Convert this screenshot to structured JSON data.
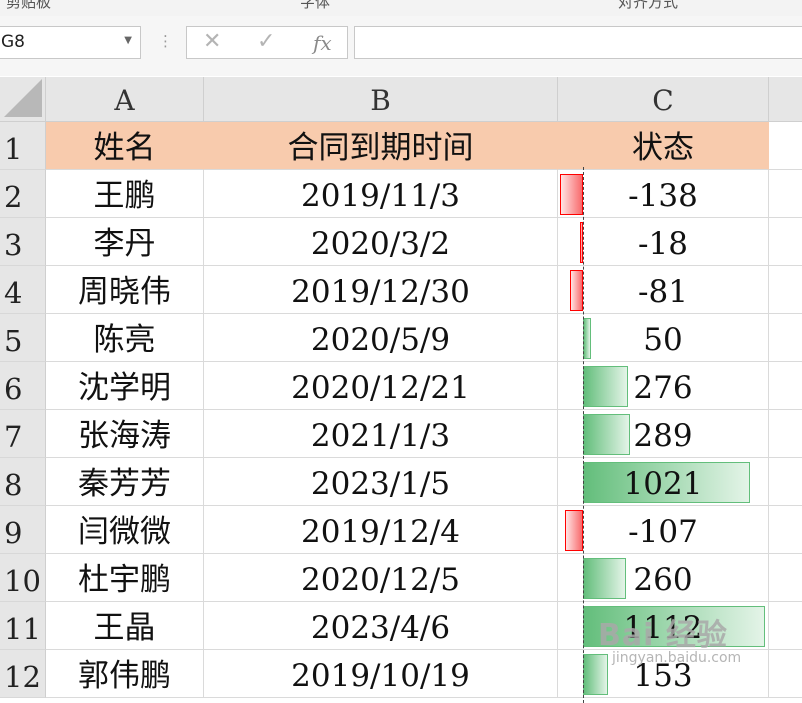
{
  "ribbon": {
    "groups": [
      "剪贴板",
      "字体",
      "对齐方式"
    ]
  },
  "formula_bar": {
    "name_box": "G8",
    "cancel_icon": "✕",
    "enter_icon": "✓",
    "function_label": "fx",
    "formula": ""
  },
  "columns": [
    "A",
    "B",
    "C"
  ],
  "row_numbers": [
    "1",
    "2",
    "3",
    "4",
    "5",
    "6",
    "7",
    "8",
    "9",
    "10",
    "11",
    "12"
  ],
  "header_row": {
    "name": "姓名",
    "date": "合同到期时间",
    "status": "状态",
    "fill_color": "#f8cbad"
  },
  "rows": [
    {
      "name": "王鹏",
      "date": "2019/11/3",
      "status": -138
    },
    {
      "name": "李丹",
      "date": "2020/3/2",
      "status": -18
    },
    {
      "name": "周晓伟",
      "date": "2019/12/30",
      "status": -81
    },
    {
      "name": "陈亮",
      "date": "2020/5/9",
      "status": 50
    },
    {
      "name": "沈学明",
      "date": "2020/12/21",
      "status": 276
    },
    {
      "name": "张海涛",
      "date": "2021/1/3",
      "status": 289
    },
    {
      "name": "秦芳芳",
      "date": "2023/1/5",
      "status": 1021
    },
    {
      "name": "闫微微",
      "date": "2019/12/4",
      "status": -107
    },
    {
      "name": "杜宇鹏",
      "date": "2020/12/5",
      "status": 260
    },
    {
      "name": "王晶",
      "date": "2023/4/6",
      "status": 1112
    },
    {
      "name": "郭伟鹏",
      "date": "2019/10/19",
      "status": 153
    }
  ],
  "data_bar_colors": {
    "positive": "#63be7b",
    "negative": "#ff0000"
  },
  "watermark": {
    "main": "Bai 经验",
    "sub": "jingyan.baidu.com"
  }
}
